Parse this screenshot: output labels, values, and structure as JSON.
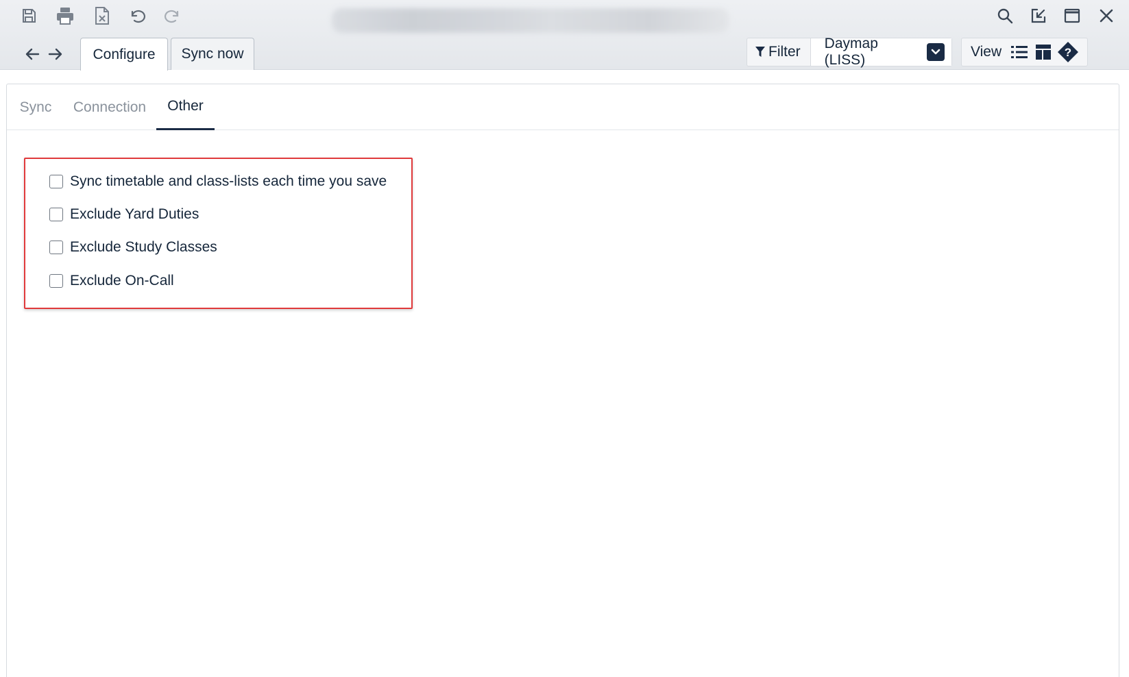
{
  "toolbar": {
    "icons": [
      "save-icon",
      "print-icon",
      "export-excel-icon",
      "undo-icon",
      "redo-icon"
    ],
    "window_icons": [
      "search-icon",
      "popout-icon",
      "maximize-icon",
      "close-icon"
    ]
  },
  "nav": {
    "icons": [
      "back-arrow-icon",
      "forward-arrow-icon"
    ]
  },
  "tabs": [
    {
      "label": "Configure",
      "active": true
    },
    {
      "label": "Sync now",
      "active": false
    }
  ],
  "filter": {
    "label": "Filter",
    "selected_value": "Daymap (LISS)"
  },
  "view": {
    "label": "View",
    "icons": [
      "list-view-icon",
      "table-layout-icon",
      "help-icon"
    ]
  },
  "subtabs": [
    {
      "label": "Sync",
      "active": false
    },
    {
      "label": "Connection",
      "active": false
    },
    {
      "label": "Other",
      "active": true
    }
  ],
  "options": [
    {
      "label": "Sync timetable and class-lists each time you save",
      "checked": false
    },
    {
      "label": "Exclude Yard Duties",
      "checked": false
    },
    {
      "label": "Exclude Study Classes",
      "checked": false
    },
    {
      "label": "Exclude On-Call",
      "checked": false
    }
  ],
  "colors": {
    "accent": "#1a2b45",
    "highlight_border": "#e0393b"
  }
}
